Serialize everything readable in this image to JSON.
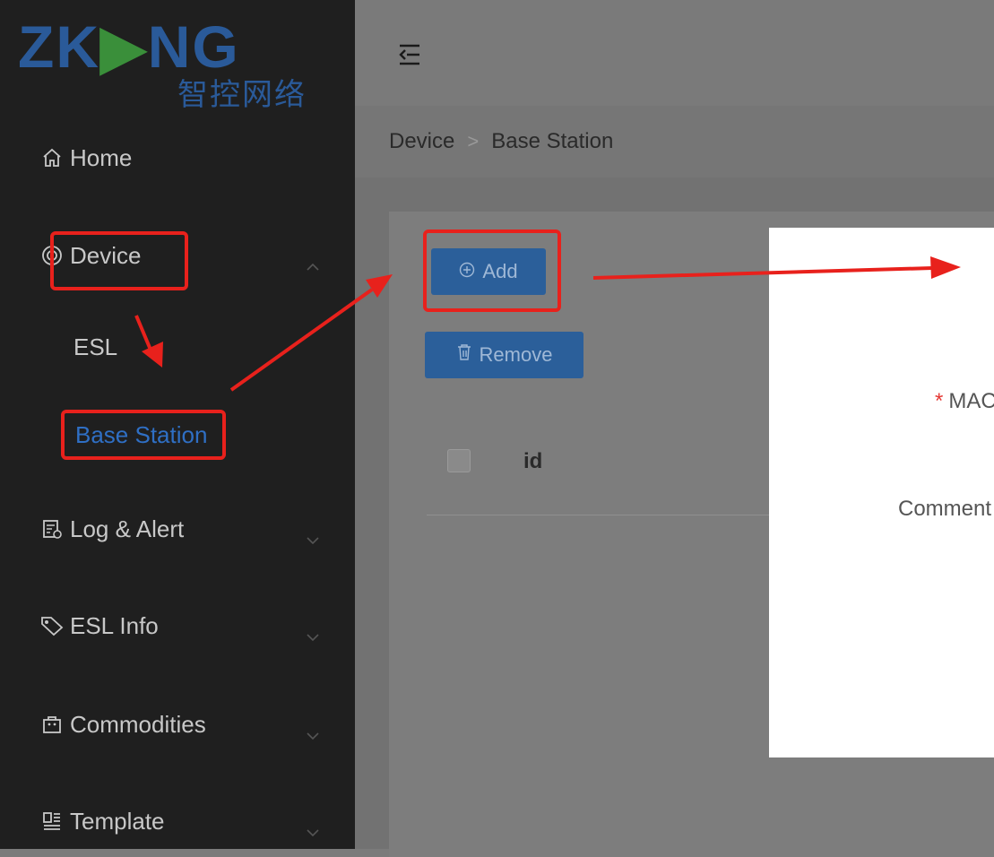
{
  "logo": {
    "main": "ZKONG",
    "sub": "智控网络"
  },
  "sidebar": {
    "items": [
      {
        "label": "Home"
      },
      {
        "label": "Device"
      },
      {
        "label": "Log & Alert"
      },
      {
        "label": "ESL Info"
      },
      {
        "label": "Commodities"
      },
      {
        "label": "Template"
      }
    ],
    "device_sub": [
      {
        "label": "ESL"
      },
      {
        "label": "Base Station"
      }
    ]
  },
  "breadcrumb": [
    "Device",
    "Base Station"
  ],
  "toolbar": {
    "add_label": "Add",
    "remove_label": "Remove"
  },
  "table": {
    "columns": [
      "id"
    ]
  },
  "modal": {
    "fields": [
      {
        "label": "MAC",
        "required": true
      },
      {
        "label": "Comment",
        "required": false
      }
    ]
  },
  "colors": {
    "accent": "#2f6fc4",
    "annotation": "#e8211c",
    "sidebar_bg": "#1f1f1f"
  }
}
